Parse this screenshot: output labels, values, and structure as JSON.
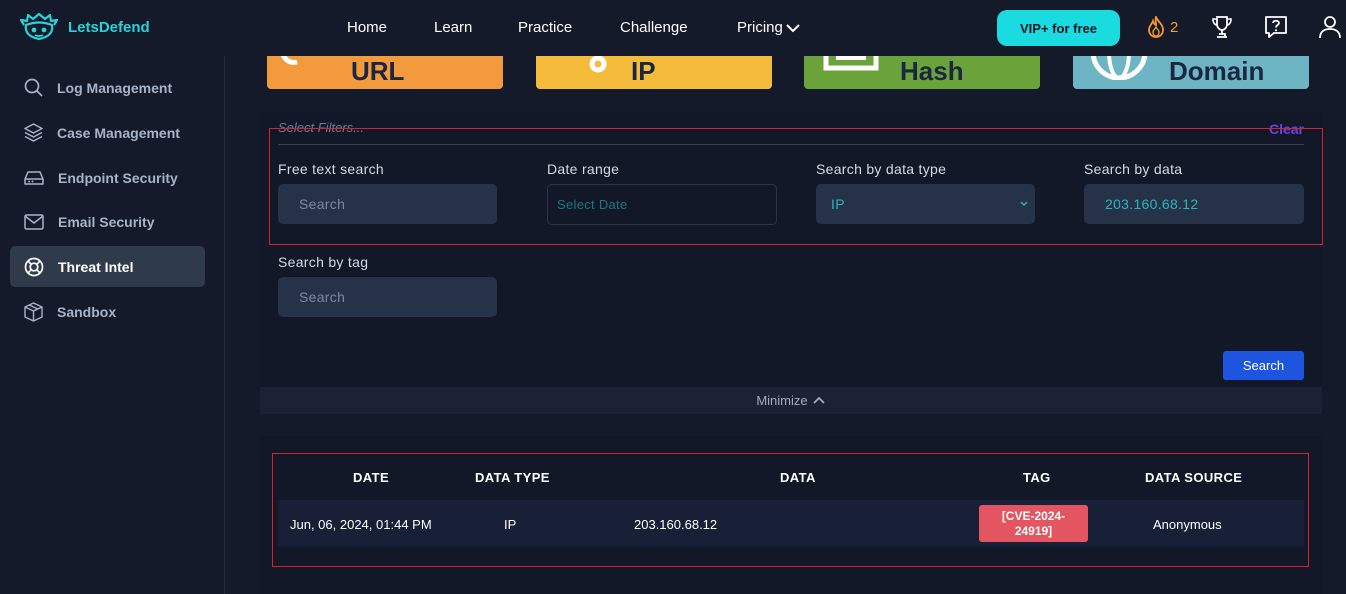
{
  "brand": {
    "name": "LetsDefend"
  },
  "nav": {
    "home": "Home",
    "learn": "Learn",
    "practice": "Practice",
    "challenge": "Challenge",
    "pricing": "Pricing"
  },
  "header": {
    "vip_label": "VIP+ for free",
    "streak_count": "2"
  },
  "sidebar": {
    "items": [
      {
        "label": "Log Management",
        "icon": "search-icon"
      },
      {
        "label": "Case Management",
        "icon": "layers-icon"
      },
      {
        "label": "Endpoint Security",
        "icon": "drive-icon"
      },
      {
        "label": "Email Security",
        "icon": "mail-icon"
      },
      {
        "label": "Threat Intel",
        "icon": "lifebuoy-icon",
        "active": true
      },
      {
        "label": "Sandbox",
        "icon": "cube-icon"
      }
    ]
  },
  "cards": [
    {
      "label": "URL",
      "color": "#f39a3d"
    },
    {
      "label": "IP",
      "color": "#f5bb3a"
    },
    {
      "label": "Hash",
      "color": "#6aa33a"
    },
    {
      "label": "Domain",
      "color": "#6db5c4"
    }
  ],
  "filters": {
    "select_label": "Select Filters...",
    "clear_label": "Clear",
    "free_text": {
      "label": "Free text search",
      "placeholder": "Search"
    },
    "date_range": {
      "label": "Date range",
      "placeholder": "Select Date"
    },
    "data_type": {
      "label": "Search by data type",
      "value": "IP"
    },
    "data": {
      "label": "Search by data",
      "value": "203.160.68.12"
    },
    "tag": {
      "label": "Search by tag",
      "placeholder": "Search"
    },
    "search_button": "Search",
    "minimize_label": "Minimize"
  },
  "results": {
    "columns": [
      "DATE",
      "DATA TYPE",
      "DATA",
      "TAG",
      "DATA SOURCE"
    ],
    "rows": [
      {
        "date": "Jun, 06, 2024, 01:44 PM",
        "data_type": "IP",
        "data": "203.160.68.12",
        "tag": "[CVE-2024-24919]",
        "source": "Anonymous"
      }
    ]
  }
}
